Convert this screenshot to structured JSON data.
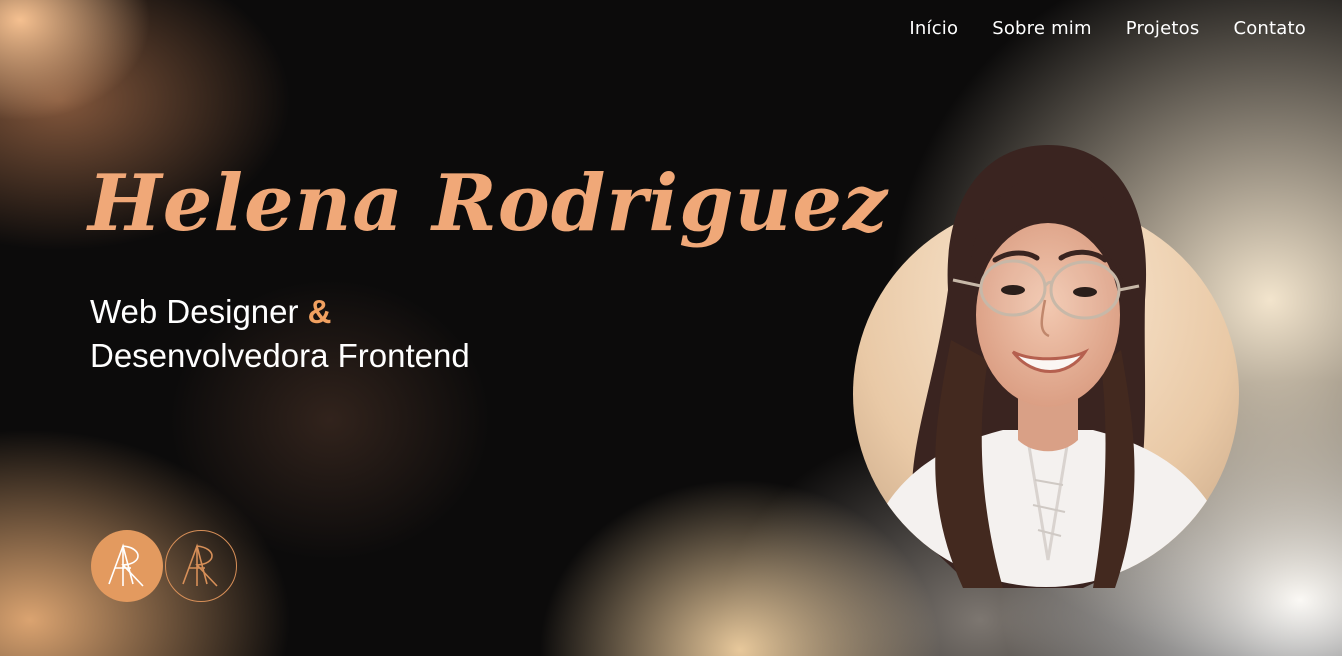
{
  "nav": {
    "items": [
      {
        "label": "Início"
      },
      {
        "label": "Sobre mim"
      },
      {
        "label": "Projetos"
      },
      {
        "label": "Contato"
      }
    ]
  },
  "hero": {
    "name": "Helena Rodriguez",
    "subtitle_line1": "Web Designer ",
    "ampersand": "&",
    "subtitle_line2": "Desenvolvedora Frontend"
  },
  "logos": {
    "filled_icon": "ar-monogram-filled-icon",
    "outline_icon": "ar-monogram-outline-icon"
  },
  "colors": {
    "accent": "#f0a878",
    "logo_fill": "#e39a5f",
    "background": "#0c0b0b"
  }
}
